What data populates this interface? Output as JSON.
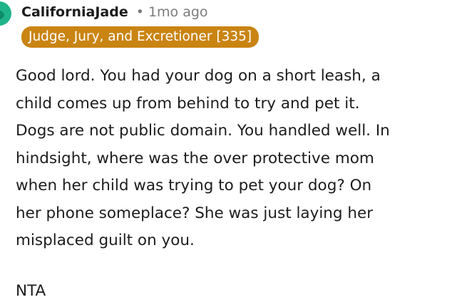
{
  "comment": {
    "username": "CaliforniaJade",
    "separator": "•",
    "timestamp": "1mo ago",
    "flair": "Judge, Jury, and Excretioner [335]",
    "paragraphs": [
      "Good lord. You had your dog on a short leash, a\nchild comes up from behind to try and pet it.\nDogs are not public domain. You handled well. In\nhindsight, where was the over protective mom\nwhen her child was trying to pet your dog? On\nher phone someplace? She was just laying her\nmisplaced guilt on you.",
      "NTA"
    ]
  },
  "colors": {
    "flair_background": "#c98412",
    "avatar": "#1fb48a",
    "meta_text": "#7c7c7c",
    "body_text": "#1c1c1c"
  },
  "icons": {
    "avatar": "user-avatar-icon"
  }
}
